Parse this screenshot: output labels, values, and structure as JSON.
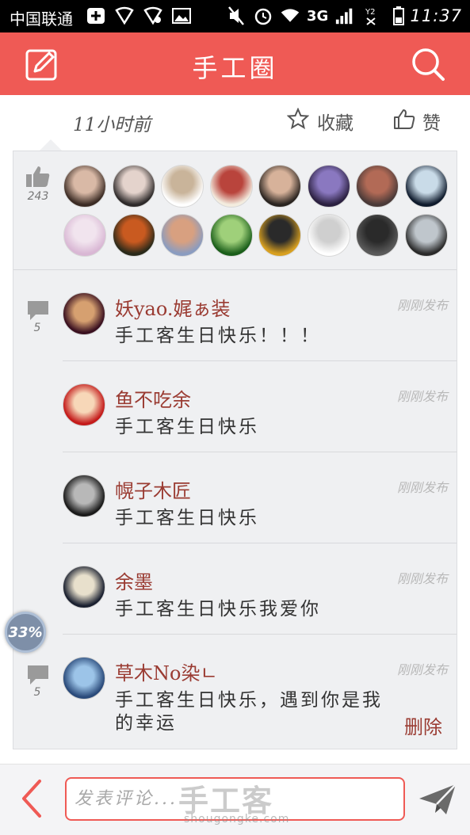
{
  "status_bar": {
    "carrier": "中国联通",
    "network": "3G",
    "time": "11:37",
    "icons": [
      "add-box-icon",
      "wifi-shield-icon",
      "wifi-shield-2-icon",
      "image-icon",
      "mute-icon",
      "alarm-icon",
      "wifi-icon",
      "signal-icon",
      "sim2-icon",
      "battery-icon"
    ]
  },
  "header": {
    "title": "手工圈",
    "left_icon": "edit-icon",
    "right_icon": "search-icon",
    "bg_color": "#ef5a55"
  },
  "post_meta": {
    "time_ago": "11小时前",
    "favorite_label": "收藏",
    "like_label": "赞"
  },
  "likes": {
    "count": "243",
    "avatars": [
      {
        "colors": [
          "#3b2b24",
          "#d9b9a6"
        ]
      },
      {
        "colors": [
          "#2e2a2a",
          "#e4d3cc"
        ]
      },
      {
        "colors": [
          "#ffffff",
          "#c9b49a"
        ]
      },
      {
        "colors": [
          "#f3ecdf",
          "#b9443c"
        ]
      },
      {
        "colors": [
          "#2a2420",
          "#d7b29a"
        ]
      },
      {
        "colors": [
          "#2b2040",
          "#8a78c0"
        ]
      },
      {
        "colors": [
          "#4a3a38",
          "#b26a56"
        ]
      },
      {
        "colors": [
          "#0e1a2c",
          "#c9dbe8"
        ]
      },
      {
        "colors": [
          "#d9b7d4",
          "#f1e4ee"
        ]
      },
      {
        "colors": [
          "#2a2a1a",
          "#c95a20"
        ]
      },
      {
        "colors": [
          "#8a9cc0",
          "#d8a080"
        ]
      },
      {
        "colors": [
          "#1a5e1a",
          "#9fd07a"
        ]
      },
      {
        "colors": [
          "#d8a020",
          "#2a2a2a"
        ]
      },
      {
        "colors": [
          "#ffffff",
          "#cfcfcf"
        ]
      },
      {
        "colors": [
          "#5a5a5a",
          "#2a2a2a"
        ]
      },
      {
        "colors": [
          "#2a2a2a",
          "#bfc6cc"
        ]
      }
    ]
  },
  "comments": [
    {
      "name": "妖yao.娓ぁ装",
      "text": "手工客生日快乐！！！",
      "time": "刚刚发布",
      "comment_count": "5",
      "avatar_colors": [
        "#3a1020",
        "#d6a070"
      ]
    },
    {
      "name": "鱼不吃余",
      "text": "手工客生日快乐",
      "time": "刚刚发布",
      "avatar_colors": [
        "#c41a1a",
        "#f7d7b8"
      ]
    },
    {
      "name": "幌子木匠",
      "text": "手工客生日快乐",
      "time": "刚刚发布",
      "avatar_colors": [
        "#1a1a1a",
        "#b8b8b8"
      ]
    },
    {
      "name": "余墨",
      "text": "手工客生日快乐我爱你",
      "time": "刚刚发布",
      "avatar_colors": [
        "#1a2030",
        "#e8e0cc"
      ]
    },
    {
      "name": "草木No染ㄴ",
      "text": "手工客生日快乐，遇到你是我的幸运",
      "time": "刚刚发布",
      "comment_count": "5",
      "avatar_colors": [
        "#2a4a7a",
        "#9cc4e8"
      ],
      "action": "删除"
    }
  ],
  "progress": {
    "label": "33%",
    "value": 0.33
  },
  "bottom_bar": {
    "comment_placeholder": "发表评论...",
    "back_icon": "back-icon",
    "send_icon": "send-icon"
  },
  "watermark": {
    "main": "手工客",
    "sub": "shougongke.com"
  }
}
